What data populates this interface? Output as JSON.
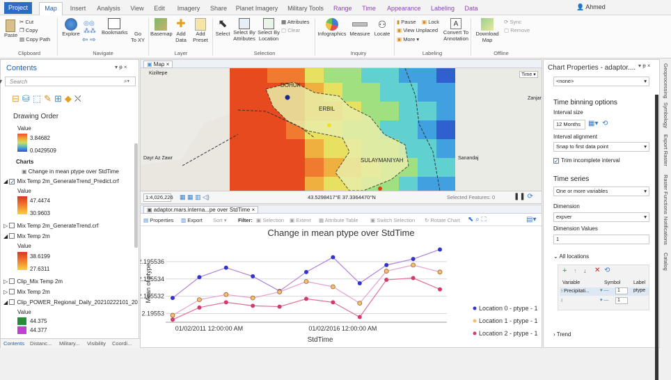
{
  "tabs": [
    "Project",
    "Map",
    "Insert",
    "Analysis",
    "View",
    "Edit",
    "Imagery",
    "Share",
    "Planet Imagery",
    "Military Tools",
    "Range",
    "Time",
    "Appearance",
    "Labeling",
    "Data"
  ],
  "user": "Ahmed",
  "ribbon": {
    "clipboard": {
      "cut": "Cut",
      "copy": "Copy",
      "paste": "Paste",
      "copy_path": "Copy Path",
      "group": "Clipboard"
    },
    "navigate": {
      "explore": "Explore",
      "bookmarks": "Bookmarks",
      "goto": "Go To XY",
      "go": "Go",
      "to_xy": "To XY",
      "group": "Navigate"
    },
    "layer": {
      "basemap": "Basemap",
      "add_data_1": "Add",
      "add_data_2": "Data",
      "add_preset_1": "Add",
      "add_preset_2": "Preset",
      "group": "Layer"
    },
    "selection": {
      "select": "Select",
      "sba_1": "Select By",
      "sba_2": "Attributes",
      "sbl_1": "Select By",
      "sbl_2": "Location",
      "attributes": "Attributes",
      "clear": "Clear",
      "group": "Selection"
    },
    "inquiry": {
      "infographics": "Infographics",
      "measure": "Measure",
      "locate": "Locate",
      "group": "Inquiry"
    },
    "labeling": {
      "pause": "Pause",
      "lock": "Lock",
      "view_unplaced": "View Unplaced",
      "more": "More",
      "convert_1": "Convert To",
      "convert_2": "Annotation",
      "group": "Labeling"
    },
    "offline": {
      "download_1": "Download",
      "download_2": "Map",
      "sync": "Sync",
      "remove": "Remove",
      "group": "Offline"
    }
  },
  "contents": {
    "title": "Contents",
    "pin": "▾ ᵽ ×",
    "search_placeholder": "Search",
    "drawing_order": "Drawing Order",
    "value_label": "Value",
    "legend1": {
      "max": "3.84682",
      "min": "0.0429509"
    },
    "charts": "Charts",
    "chart_item": "Change in mean ptype over StdTime",
    "layer2": "Mix Temp 2m_GenerateTrend_Predict.crf",
    "legend2": {
      "max": "47.4474",
      "min": "30.9603"
    },
    "layer3": "Mix Temp 2m_GenerateTrend.crf",
    "layer4": "Mix Temp 2m",
    "legend4": {
      "max": "38.6199",
      "min": "27.6311"
    },
    "layer5": "Clip_Mix Temp 2m",
    "layer6": "Mix Temp 2m",
    "layer7": "Clip_POWER_Regional_Daily_20210222101_20",
    "legend7": {
      "a": "44.375",
      "b": "44.377"
    },
    "bottom_tabs": [
      "Contents",
      "Distanc...",
      "Military...",
      "Visibility",
      "Coordi..."
    ]
  },
  "map": {
    "tab": "Map",
    "time_btn": "Time ▾",
    "labels": {
      "kiziltepe": "Kiziltepe",
      "dohuk": "DOHUK",
      "erbil": "ERBIL",
      "suly": "SULAYMANIYAH",
      "dayr": "Dayr Az Zawr",
      "sanandaj": "Sanandaj",
      "zanjan": "Zanjar"
    },
    "scale": "1:4,026,226",
    "coords": "43.5298417°E 37.3364470°N",
    "selected": "Selected Features: 0"
  },
  "chart_view": {
    "tab": "adaptor.mars.interna...pe over StdTime",
    "toolbar": {
      "properties": "Properties",
      "export": "Export",
      "sort": "Sort",
      "filter": "Filter:",
      "selection": "Selection",
      "extent": "Extent",
      "attr_table": "Attribute Table",
      "switch_sel": "Switch Selection",
      "rotate": "Rotate Chart"
    }
  },
  "chart_data": {
    "type": "line",
    "title": "Change in mean ptype over StdTime",
    "xlabel": "StdTime",
    "ylabel": "Mean of ptype",
    "yticks": [
      "2.195536",
      "2.195534",
      "2.195532",
      "2.19553"
    ],
    "xticks": [
      "01/02/2011 12:00:00 AM",
      "01/02/2016 12:00:00 AM"
    ],
    "ylim": [
      2.195529,
      2.195538
    ],
    "x": [
      1,
      2,
      3,
      4,
      5,
      6,
      7,
      8,
      9,
      10,
      11
    ],
    "series": [
      {
        "name": "Location 0 - ptype - 1",
        "color": "#3333cc",
        "line": "#b07fd8",
        "values": [
          2.1955318,
          2.1955342,
          2.1955353,
          2.1955343,
          2.1955326,
          2.1955348,
          2.1955365,
          2.1955335,
          2.1955356,
          2.1955363,
          2.1955374
        ]
      },
      {
        "name": "Location 1 - ptype - 1",
        "color": "#f0c070",
        "line": "#e8a0d0",
        "values": [
          2.1955298,
          2.1955316,
          2.1955322,
          2.1955318,
          2.1955325,
          2.1955337,
          2.1955331,
          2.1955312,
          2.1955349,
          2.1955356,
          2.1955348
        ]
      },
      {
        "name": "Location 2 - ptype - 1",
        "color": "#d03b6a",
        "line": "#e0709a",
        "values": [
          2.1955293,
          2.1955307,
          2.1955313,
          2.1955309,
          2.1955308,
          2.1955317,
          2.1955313,
          2.1955296,
          2.1955339,
          2.1955341,
          2.1955328
        ]
      }
    ]
  },
  "chart_props": {
    "title": "Chart Properties - adaptor....",
    "pin": "▾ ᵽ ×",
    "none": "<none>",
    "time_binning": "Time binning options",
    "interval_size": "Interval size",
    "interval_value": "12 Months",
    "interval_alignment": "Interval alignment",
    "alignment_value": "Snap to first data point",
    "trim": "Trim incomplete interval",
    "time_series": "Time series",
    "ts_value": "One or more variables",
    "dimension": "Dimension",
    "dimension_value": "expver",
    "dimension_values": "Dimension Values",
    "dv_value": "1",
    "all_locations": "All locations",
    "cols": [
      "Variable",
      "Symbol",
      "Label"
    ],
    "row1": {
      "var": "Precipitati...",
      "num": "1",
      "label": "ptype"
    },
    "row2": {
      "num": "1"
    },
    "trend": "Trend"
  },
  "right_tabs": [
    "Geoprocessing",
    "Symbology",
    "Export Raster",
    "Raster Functions",
    "Notifications",
    "Catalog"
  ]
}
